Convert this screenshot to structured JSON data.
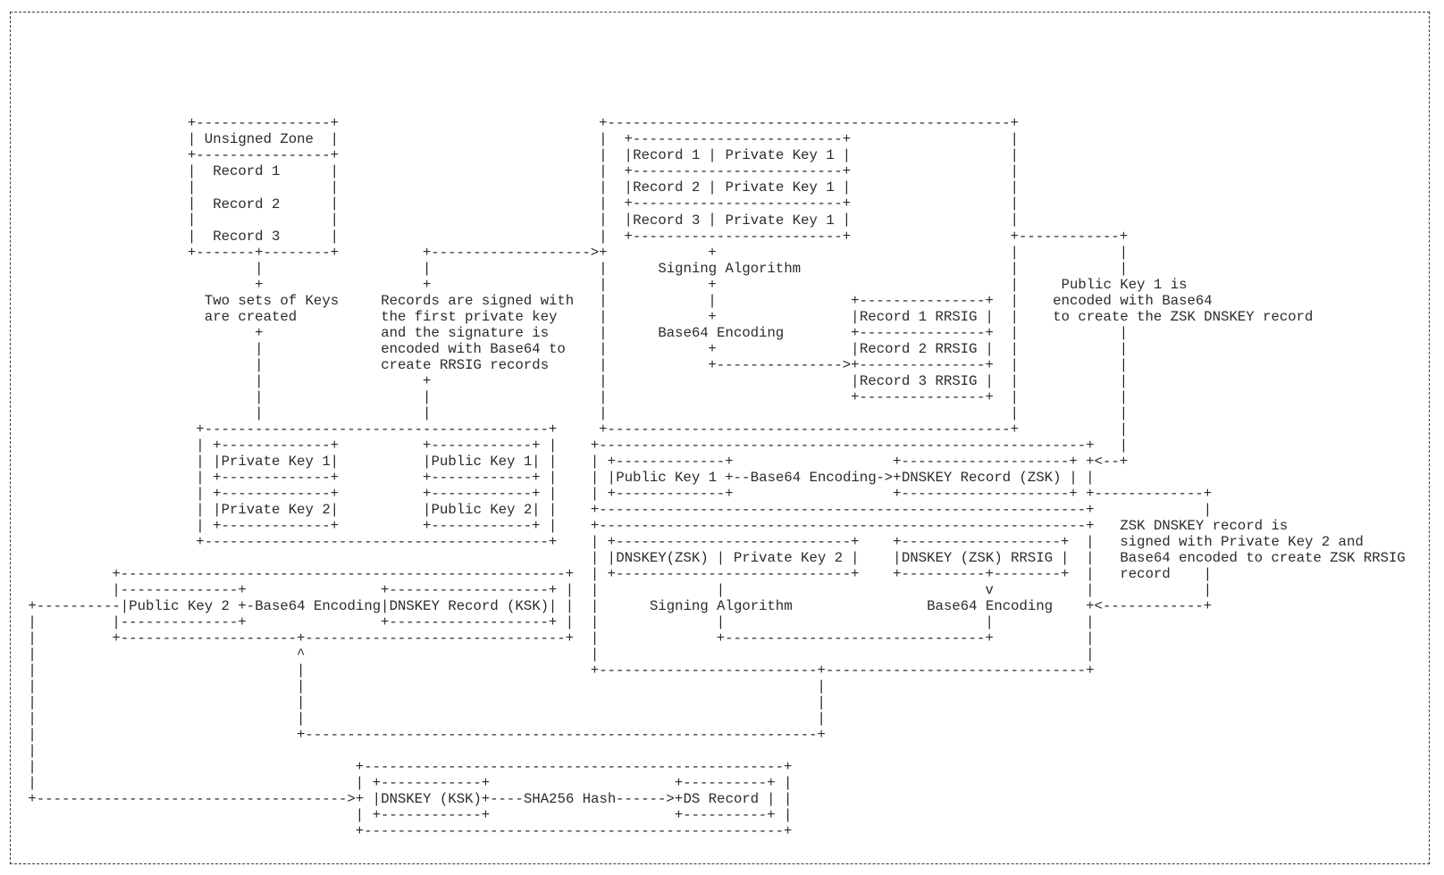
{
  "unsigned_zone": {
    "title": "Unsigned Zone",
    "records": [
      "Record 1",
      "Record 2",
      "Record 3"
    ]
  },
  "notes": {
    "keys_created": [
      "Two sets of Keys",
      "are created"
    ],
    "records_signed": [
      "Records are signed with",
      "the first private key",
      "and the signature is",
      "encoded with Base64 to",
      "create RRSIG records"
    ],
    "zsk_encoded": [
      "Public Key 1 is",
      "encoded with Base64",
      "to create the ZSK DNSKEY record"
    ],
    "zsk_signed": [
      "ZSK DNSKEY record is",
      "signed with Private Key 2 and",
      "Base64 encoded to create ZSK RRSIG",
      "record"
    ]
  },
  "signing_table": {
    "rows": [
      {
        "record": "Record 1",
        "key": "Private Key 1"
      },
      {
        "record": "Record 2",
        "key": "Private Key 1"
      },
      {
        "record": "Record 3",
        "key": "Private Key 1"
      }
    ],
    "signing_algorithm": "Signing Algorithm",
    "encoding": "Base64 Encoding",
    "rrsig": [
      "Record 1 RRSIG",
      "Record 2 RRSIG",
      "Record 3 RRSIG"
    ]
  },
  "keys": {
    "private": [
      "Private Key 1",
      "Private Key 2"
    ],
    "public": [
      "Public Key 1",
      "Public Key 2"
    ]
  },
  "zsk": {
    "public_key": "Public Key 1",
    "encoding": "Base64 Encoding",
    "dnskey": "DNSKEY Record (ZSK)",
    "sign_input": "DNSKEY(ZSK)",
    "sign_key": "Private Key 2",
    "rrsig": "DNSKEY (ZSK) RRSIG",
    "signing_algorithm": "Signing Algorithm",
    "rrsig_encoding": "Base64 Encoding"
  },
  "ksk": {
    "public_key": "Public Key 2",
    "encoding": "Base64 Encoding",
    "dnskey": "DNSKEY Record (KSK)"
  },
  "ds": {
    "input": "DNSKEY (KSK)",
    "hash": "SHA256 Hash",
    "output": "DS Record"
  }
}
